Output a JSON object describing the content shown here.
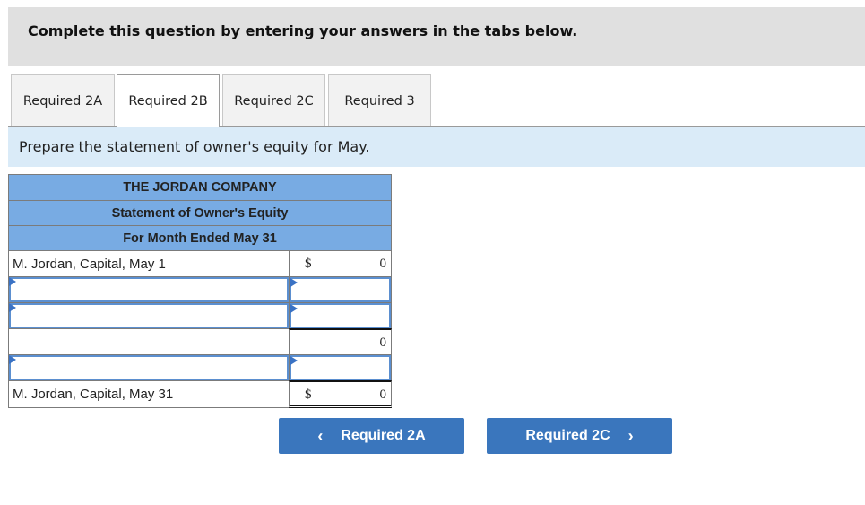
{
  "instruction": "Complete this question by entering your answers in the tabs below.",
  "tabs": [
    {
      "label": "Required 2A",
      "active": false
    },
    {
      "label": "Required 2B",
      "active": true
    },
    {
      "label": "Required 2C",
      "active": false
    },
    {
      "label": "Required 3",
      "active": false
    }
  ],
  "prompt": "Prepare the statement of owner's equity for May.",
  "statement": {
    "company": "THE JORDAN COMPANY",
    "title": "Statement of Owner's Equity",
    "period": "For Month Ended May 31",
    "rows": [
      {
        "label": "M. Jordan, Capital, May 1",
        "currency": "$",
        "amount": "0"
      },
      {
        "label": "",
        "amount": "",
        "input": true
      },
      {
        "label": "",
        "amount": "",
        "input": true
      },
      {
        "label": "",
        "amount": "0"
      },
      {
        "label": "",
        "amount": "",
        "input": true
      },
      {
        "label": "M. Jordan, Capital, May 31",
        "currency": "$",
        "amount": "0"
      }
    ]
  },
  "nav": {
    "prev_label": "Required 2A",
    "prev_icon": "chevron-left-icon",
    "prev_glyph": "‹",
    "next_label": "Required 2C",
    "next_icon": "chevron-right-icon",
    "next_glyph": "›"
  },
  "colors": {
    "header_fill": "#78abe3",
    "prompt_fill": "#daebf8",
    "button_fill": "#3a76bd",
    "input_border": "#5b8fd0"
  }
}
